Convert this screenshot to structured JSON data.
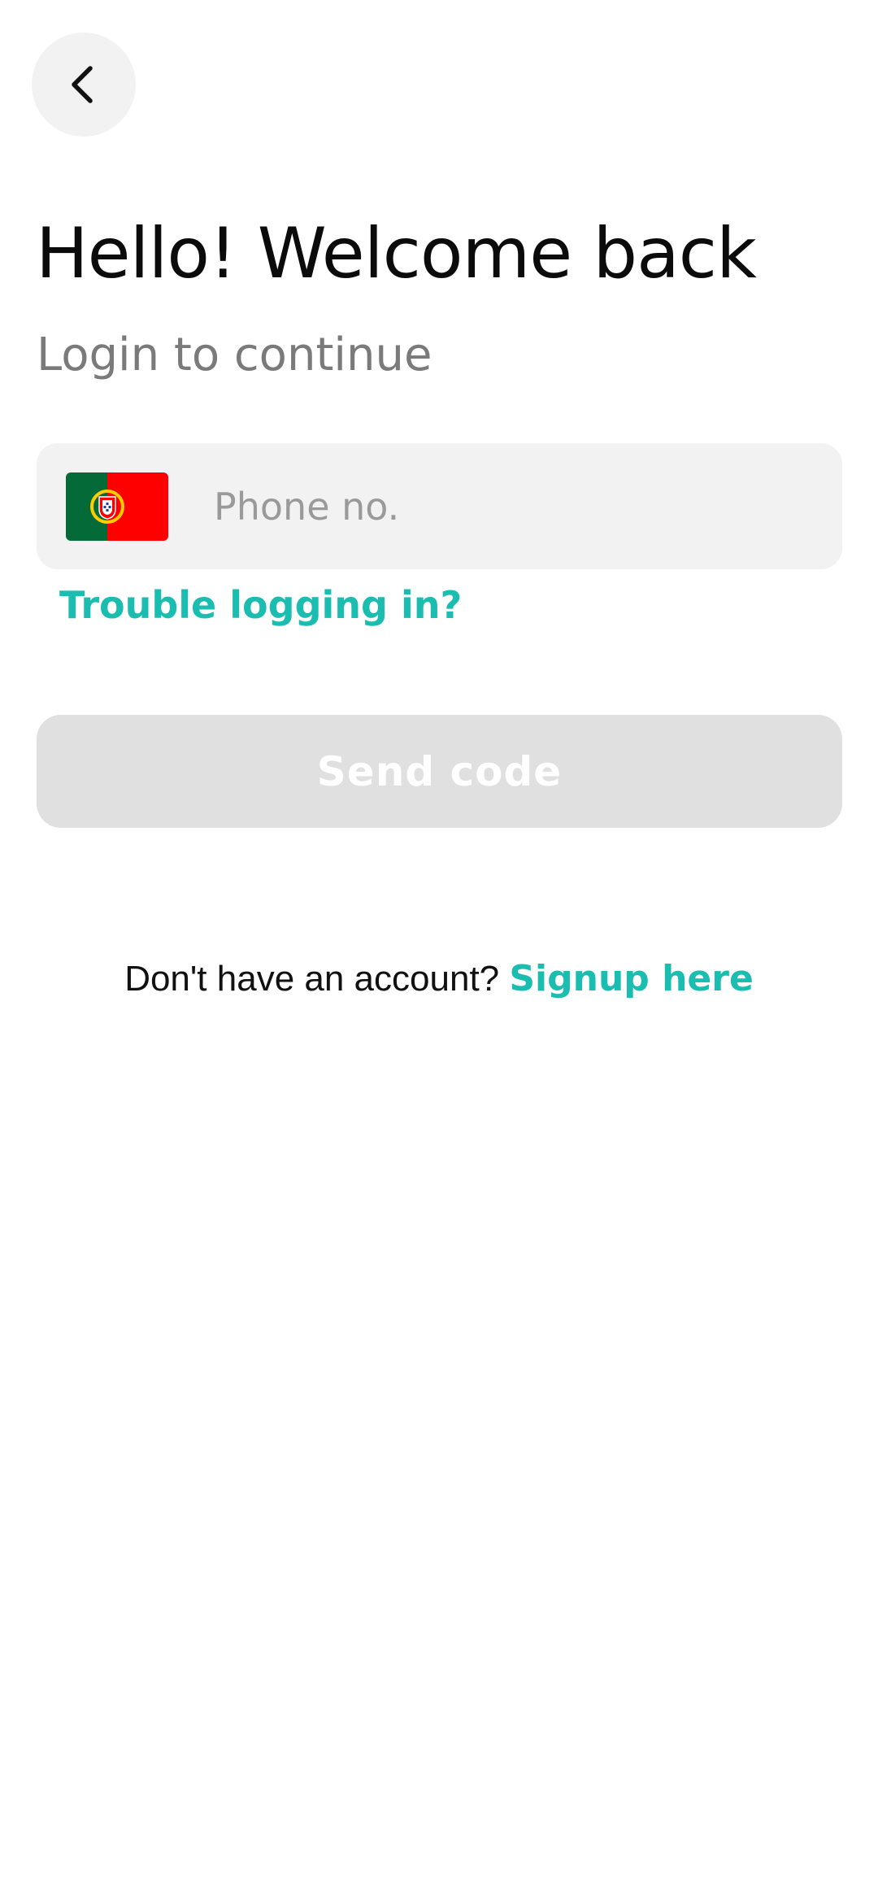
{
  "header": {
    "back_icon": "chevron-left-icon"
  },
  "title": "Hello! Welcome back",
  "subtitle": "Login to continue",
  "phone": {
    "country_flag_icon": "portugal-flag-icon",
    "value": "",
    "placeholder": "Phone no."
  },
  "trouble_link": "Trouble logging in?",
  "send_button": {
    "label": "Send code",
    "enabled": false
  },
  "signup": {
    "prompt": "Don't have an account?",
    "link": "Signup here"
  },
  "colors": {
    "accent": "#1bbdb0",
    "field_background": "#f2f2f2",
    "button_disabled": "#e0e0e0",
    "flag_green": "#046a38",
    "flag_red": "#ff0000",
    "flag_gold": "#ffcc00"
  }
}
